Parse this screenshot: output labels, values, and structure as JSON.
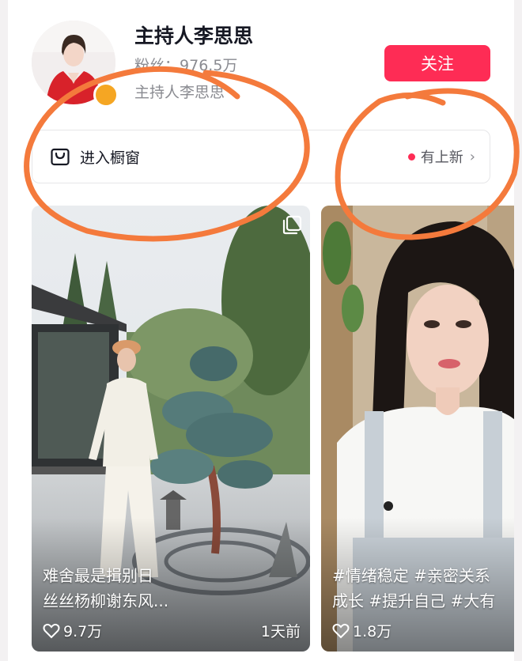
{
  "profile": {
    "name": "主持人李思思",
    "fans_label": "粉丝：",
    "fans_count": "976.5万",
    "alias": "主持人李思思",
    "follow_label": "关注"
  },
  "shop": {
    "label": "进入橱窗",
    "new_label": "有上新",
    "chevron": "›"
  },
  "posts": [
    {
      "caption_line1": "难舍最是揖别日",
      "caption_line2": "丝丝杨柳谢东风...",
      "likes": "9.7万",
      "time": "1天前",
      "icon": "multi-image-icon"
    },
    {
      "caption_line1": "#情绪稳定 #亲密关系",
      "caption_line2": "成长 #提升自己 #大有",
      "likes": "1.8万"
    }
  ],
  "colors": {
    "accent": "#fe2c55",
    "annotation": "#f47a3c",
    "live_badge": "#f5a623"
  }
}
